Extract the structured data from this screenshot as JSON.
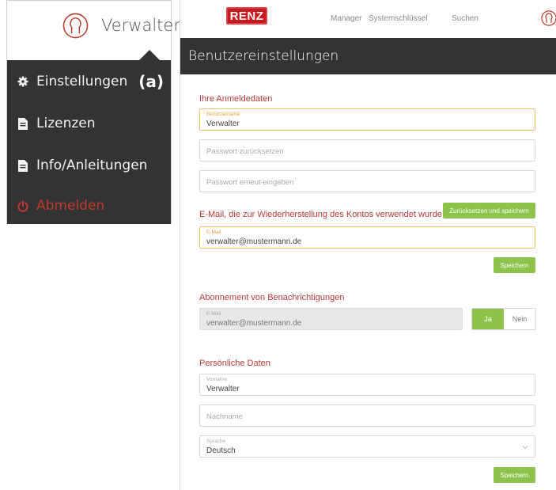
{
  "left_menu": {
    "username": "Verwalter",
    "items": [
      {
        "label": "Einstellungen",
        "icon": "gear-icon",
        "tag": "(a)"
      },
      {
        "label": "Lizenzen",
        "icon": "document-icon"
      },
      {
        "label": "Info/Anleitungen",
        "icon": "document-icon"
      },
      {
        "label": "Abmelden",
        "icon": "power-icon"
      }
    ],
    "colors": {
      "menu_bg": "#333333",
      "logout": "#c0392b"
    }
  },
  "header": {
    "logo": "RENZ",
    "nav": [
      "Manager",
      "Systemschlüssel",
      "Suchen"
    ],
    "title": "Benutzereinstellungen"
  },
  "login": {
    "section_title": "Ihre Anmeldedaten",
    "username_label": "Benutzername",
    "username_value": "Verwalter",
    "password_reset_placeholder": "Passwort zurücksetzen",
    "password_repeat_placeholder": "Passwort erneut eingeben"
  },
  "recovery": {
    "section_title": "E-Mail, die zur Wiederherstellung des Kontos verwendet wurde",
    "reset_save_button": "Zurücksetzen und speichern",
    "email_label": "E-Mail",
    "email_value": "verwalter@mustermann.de",
    "save_button": "Speichern"
  },
  "notifications": {
    "section_title": "Abonnement von Benachrichtigungen",
    "email_label": "E-Mail",
    "email_value": "verwalter@mustermann.de",
    "yes_label": "Ja",
    "no_label": "Nein",
    "selected": "Ja"
  },
  "personal": {
    "section_title": "Persönliche Daten",
    "firstname_label": "Vorname",
    "firstname_value": "Verwalter",
    "lastname_placeholder": "Nachname",
    "language_label": "Sprache",
    "language_value": "Deutsch",
    "save_button": "Speichern"
  },
  "colors": {
    "accent_green": "#8dc34a",
    "section_red": "#b83a3a",
    "focus_orange": "#f0c070",
    "titlebar": "#333333"
  }
}
